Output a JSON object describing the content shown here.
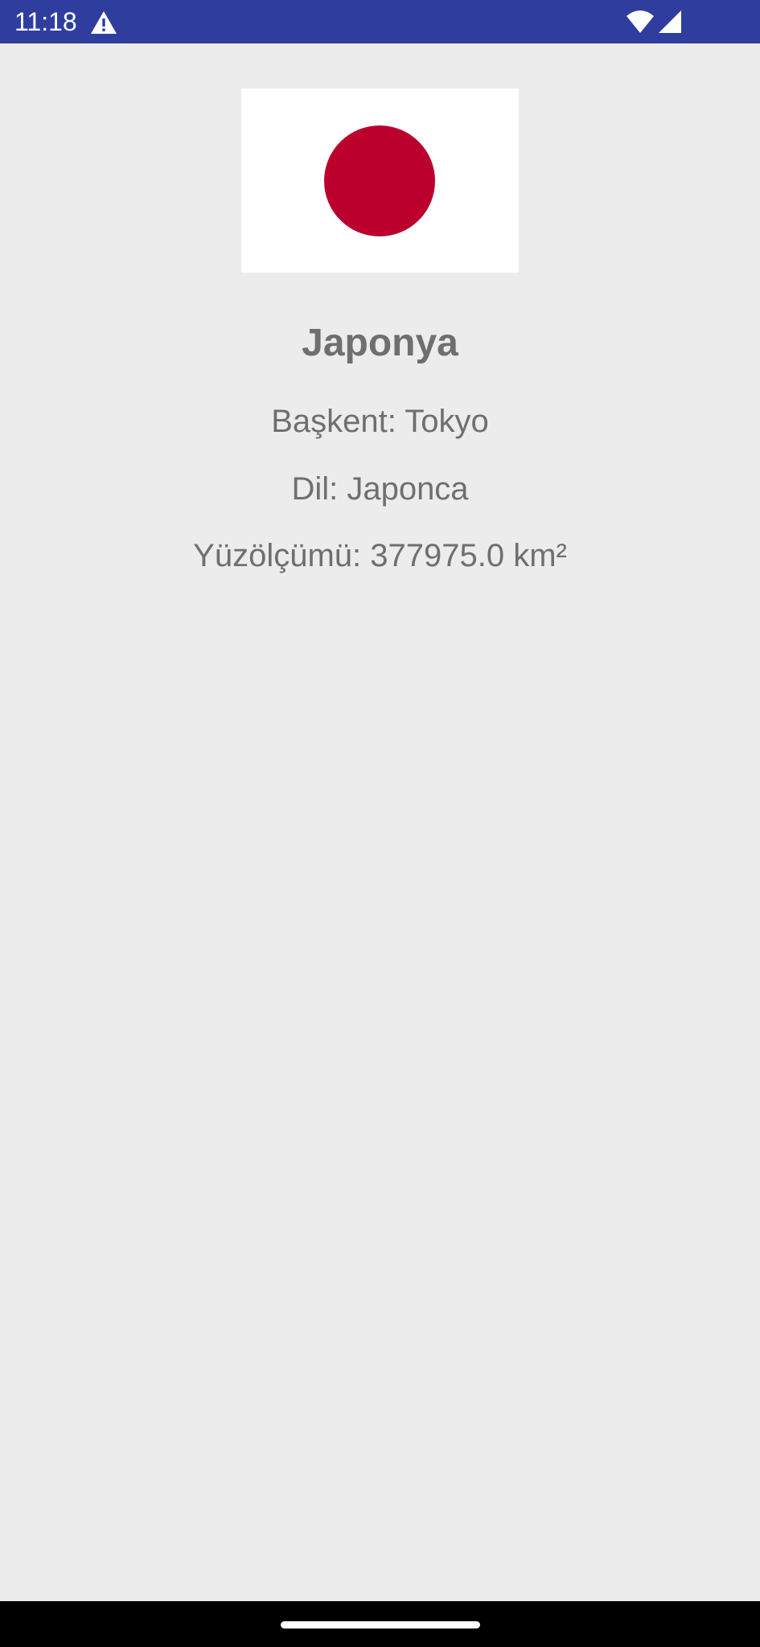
{
  "status_bar": {
    "time": "11:18",
    "background_color": "#2f3e9e",
    "icons": [
      "warning-icon",
      "wifi-icon",
      "signal-icon"
    ]
  },
  "country": {
    "name": "Japonya",
    "capital_line": "Başkent: Tokyo",
    "language_line": "Dil: Japonca",
    "area_line": "Yüzölçümü: 377975.0 km²",
    "flag": {
      "background_color": "#ffffff",
      "disc_color": "#bc002d"
    }
  },
  "colors": {
    "page_background": "#ececec",
    "text": "#6f6f6f"
  }
}
